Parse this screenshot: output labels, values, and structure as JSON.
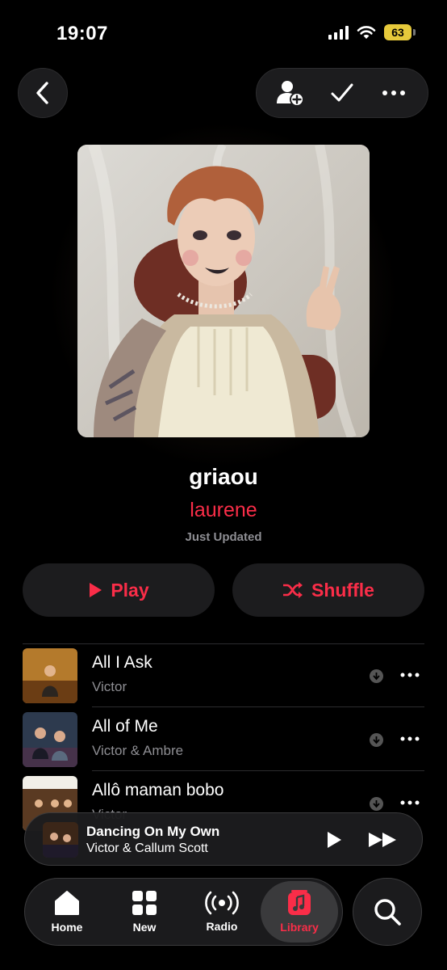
{
  "status_bar": {
    "time": "19:07",
    "battery": "63"
  },
  "header": {
    "back_icon": "chevron-left-icon",
    "add_collaborator_icon": "person-add-icon",
    "added_icon": "checkmark-icon",
    "more_icon": "ellipsis-icon"
  },
  "playlist": {
    "title": "griaou",
    "curator": "laurene",
    "updated": "Just Updated"
  },
  "actions": {
    "play_label": "Play",
    "shuffle_label": "Shuffle"
  },
  "tracks": [
    {
      "title": "All I Ask",
      "artist": "Victor"
    },
    {
      "title": "All of Me",
      "artist": "Victor & Ambre"
    },
    {
      "title": "Allô maman bobo",
      "artist": "Victor"
    }
  ],
  "now_playing": {
    "title": "Dancing On My Own",
    "artist": "Victor & Callum Scott"
  },
  "tabs": [
    {
      "label": "Home",
      "icon": "house-icon"
    },
    {
      "label": "New",
      "icon": "grid-icon"
    },
    {
      "label": "Radio",
      "icon": "radio-waves-icon"
    },
    {
      "label": "Library",
      "icon": "music-note-icon"
    }
  ],
  "search_icon": "search-icon",
  "colors": {
    "accent": "#fa2d48",
    "background": "#000000",
    "surface": "#1c1c1e",
    "secondary_text": "#8e8e93"
  }
}
